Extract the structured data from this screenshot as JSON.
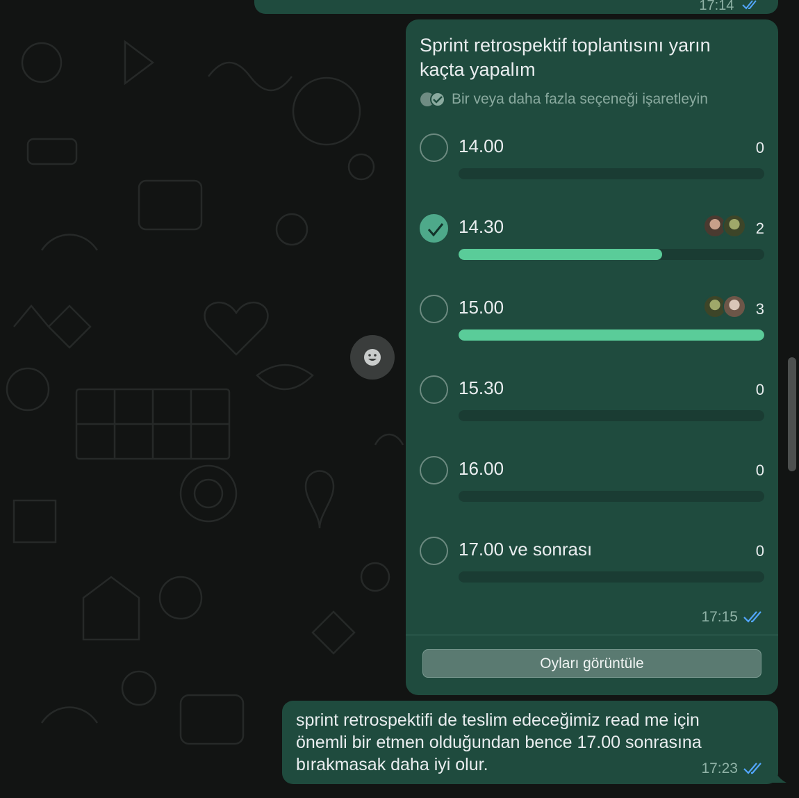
{
  "previous_message": {
    "time": "17:14"
  },
  "poll": {
    "question": "Sprint retrospektif toplantısını yarın kaçta yapalım",
    "hint": "Bir veya daha fazla seçeneği işaretleyin",
    "options": [
      {
        "label": "14.00",
        "votes": "0",
        "share": 0,
        "selected": false,
        "voters": 0
      },
      {
        "label": "14.30",
        "votes": "2",
        "share": 0.667,
        "selected": true,
        "voters": 2
      },
      {
        "label": "15.00",
        "votes": "3",
        "share": 1.0,
        "selected": false,
        "voters": 2
      },
      {
        "label": "15.30",
        "votes": "0",
        "share": 0,
        "selected": false,
        "voters": 0
      },
      {
        "label": "16.00",
        "votes": "0",
        "share": 0,
        "selected": false,
        "voters": 0
      },
      {
        "label": "17.00 ve sonrası",
        "votes": "0",
        "share": 0,
        "selected": false,
        "voters": 0
      }
    ],
    "time": "17:15",
    "view_votes_label": "Oyları görüntüle"
  },
  "message": {
    "text": "sprint retrospektifi de teslim edeceğimiz read me için önemli bir etmen olduğundan bence 17.00 sonrasına bırakmasak daha iyi olur.",
    "time": "17:23"
  },
  "colors": {
    "bubble": "#1f4b3e",
    "bar_fill": "#5acc99",
    "read_ticks": "#53a6fd"
  },
  "icons": {
    "ticks": "double-check-icon",
    "emoji": "smiley-icon",
    "multi_select": "multi-check-icon"
  }
}
